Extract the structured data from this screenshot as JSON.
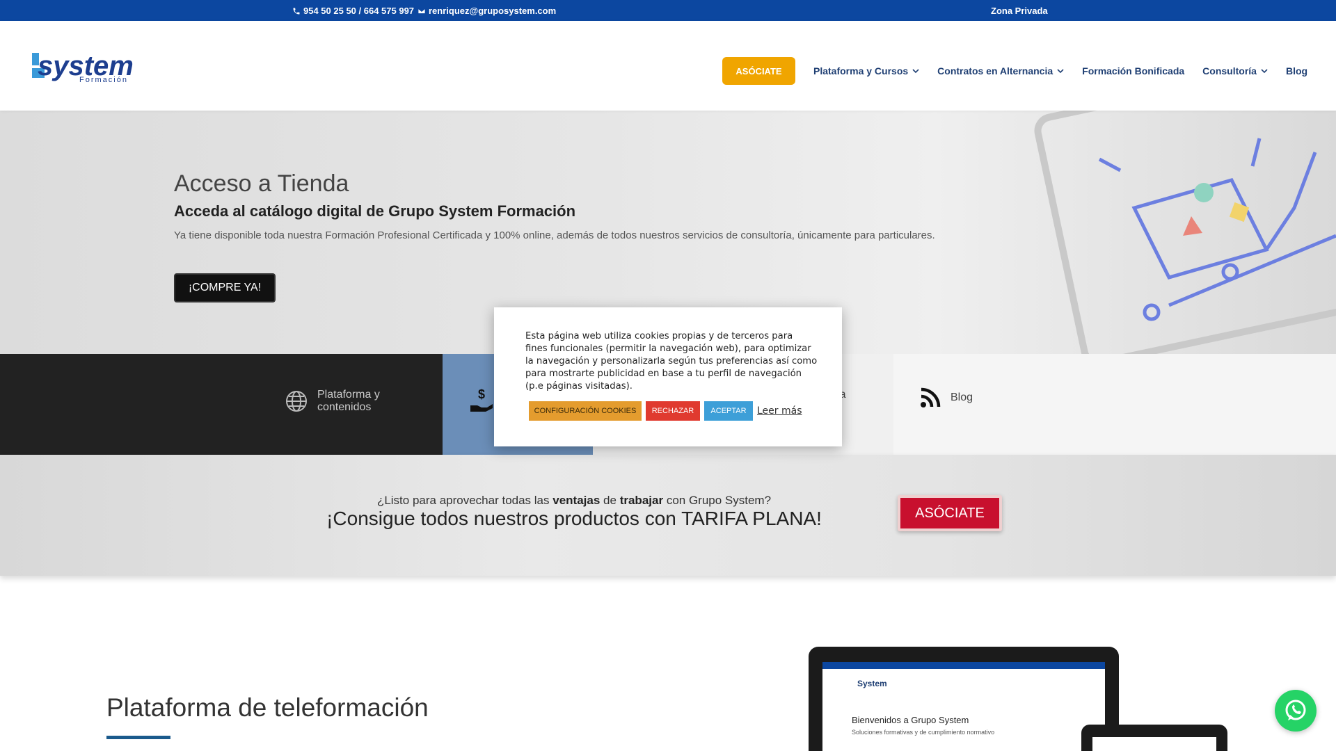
{
  "topbar": {
    "phone": "954 50 25 50 / 664 575 997",
    "email": "renriquez@gruposystem.com",
    "private_area": "Zona Privada"
  },
  "header": {
    "logo_main": "system",
    "logo_sub": "Formación",
    "nav": {
      "cta": "ASÓCIATE",
      "items": [
        "Plataforma y Cursos",
        "Contratos en Alternancia",
        "Formación Bonificada",
        "Consultoría",
        "Blog"
      ]
    }
  },
  "hero": {
    "title": "Acceso a Tienda",
    "subtitle": "Acceda al catálogo digital de Grupo System Formación",
    "body": "Ya tiene disponible toda nuestra Formación Profesional Certificada y 100% online, además de todos nuestros servicios de consultoría, únicamente para particulares.",
    "button": "¡COMPRE YA!"
  },
  "services": {
    "platform": "Plataforma y contenidos",
    "consult_partial": "ltoría",
    "blog": "Blog"
  },
  "tarifa": {
    "q_pre": "¿Listo para aprovechar todas las",
    "q_b1": "ventajas",
    "q_mid": "de",
    "q_b2": "trabajar",
    "q_post": "con Grupo System?",
    "headline": "¡Consigue todos nuestros productos con TARIFA PLANA!",
    "button": "ASÓCIATE"
  },
  "platform_section": {
    "title": "Plataforma de teleformación",
    "mock_brand": "System",
    "mock_welcome": "Bienvenidos a Grupo System",
    "mock_sub": "Soluciones formativas y de cumplimiento normativo"
  },
  "cookie": {
    "text": "Esta página web utiliza cookies propias y de terceros para fines funcionales (permitir la navegación web), para optimizar la navegación y personalizarla según tus preferencias así como para mostrarte publicidad en base a tu perfil de navegación (p.e páginas visitadas).",
    "config": "CONFIGURACIÓN COOKIES",
    "reject": "RECHAZAR",
    "accept": "ACEPTAR",
    "more": "Leer más"
  },
  "colors": {
    "topbar": "#0c47a0",
    "cta_orange": "#f0a500",
    "nav_text": "#1f3f73",
    "red_button": "#c8102e",
    "whatsapp": "#25d366"
  }
}
